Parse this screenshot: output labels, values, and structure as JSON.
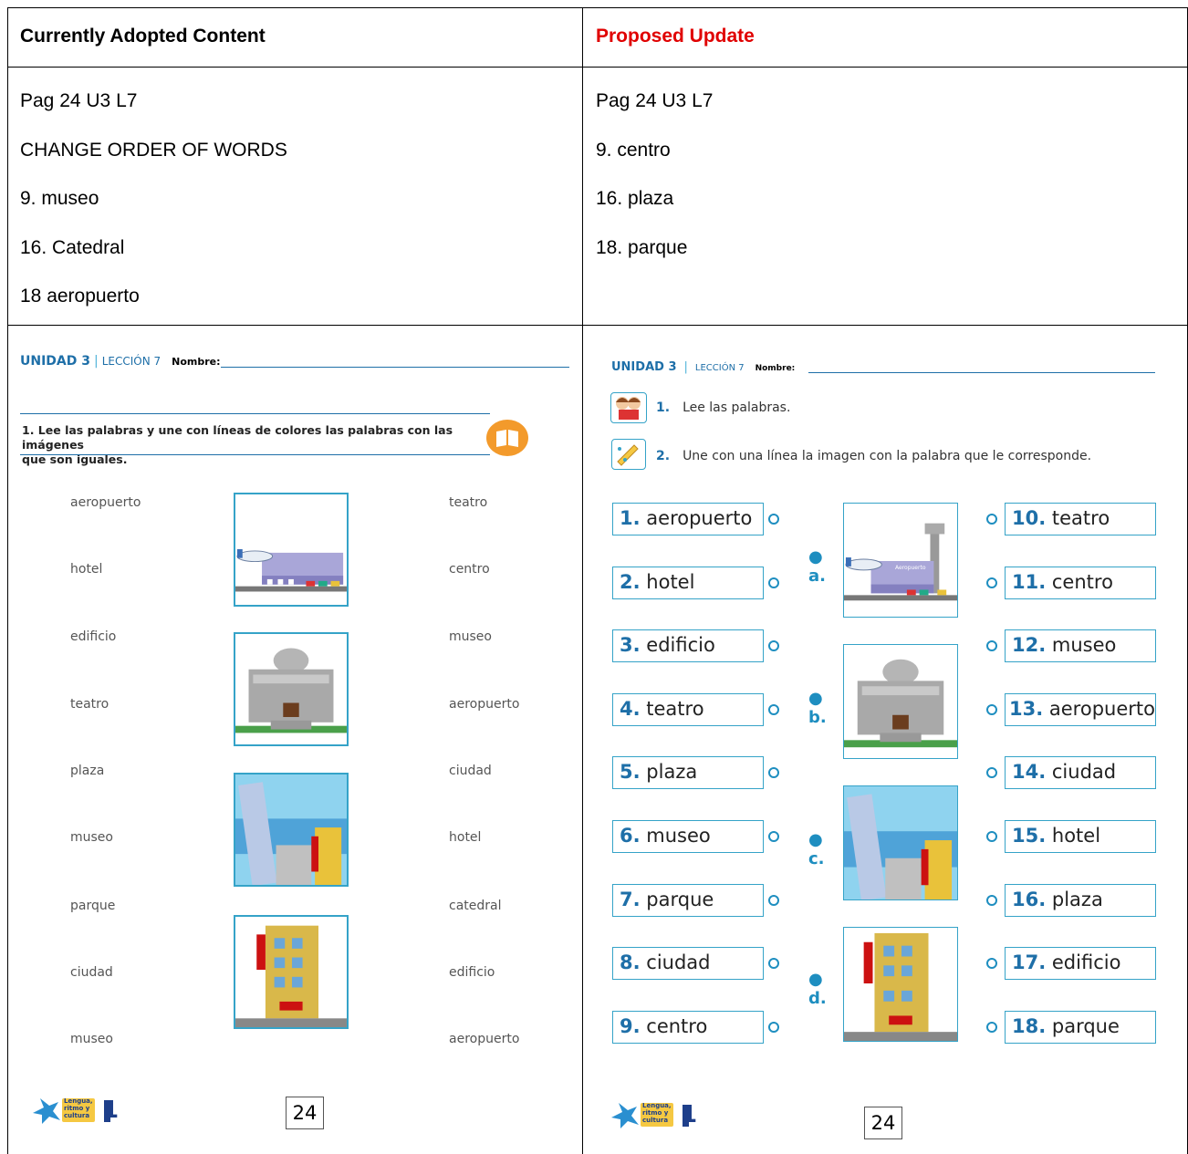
{
  "table": {
    "left_header": "Currently Adopted Content",
    "right_header": "Proposed Update",
    "left_notes": [
      "Pag 24 U3 L7",
      "CHANGE ORDER OF WORDS",
      "9. museo",
      "16. Catedral",
      "18 aeropuerto"
    ],
    "right_notes": [
      "Pag 24 U3 L7",
      "9. centro",
      "16. plaza",
      "18. parque"
    ]
  },
  "old_sheet": {
    "unidad": "UNIDAD 3",
    "leccion": "LECCIÓN 7",
    "nombre": "Nombre:",
    "instruction_line1": "1. Lee las palabras y une con líneas de colores las palabras con las imágenes",
    "instruction_line2": "que son iguales.",
    "left_words": [
      "aeropuerto",
      "hotel",
      "edificio",
      "teatro",
      "plaza",
      "museo",
      "parque",
      "ciudad",
      "museo"
    ],
    "right_words": [
      "teatro",
      "centro",
      "museo",
      "aeropuerto",
      "ciudad",
      "hotel",
      "catedral",
      "edificio",
      "aeropuerto"
    ],
    "page": "24",
    "logo_text": [
      "Lengua,",
      "ritmo y",
      "cultura"
    ],
    "logo_grade": "1"
  },
  "new_sheet": {
    "unidad": "UNIDAD 3",
    "leccion": "LECCIÓN 7",
    "nombre": "Nombre:",
    "instr1_num": "1.",
    "instr1": "Lee las palabras.",
    "instr2_num": "2.",
    "instr2": "Une con una línea la imagen con la palabra que le corresponde.",
    "left_words": [
      {
        "n": "1.",
        "w": "aeropuerto"
      },
      {
        "n": "2.",
        "w": "hotel"
      },
      {
        "n": "3.",
        "w": "edificio"
      },
      {
        "n": "4.",
        "w": "teatro"
      },
      {
        "n": "5.",
        "w": "plaza"
      },
      {
        "n": "6.",
        "w": "museo"
      },
      {
        "n": "7.",
        "w": "parque"
      },
      {
        "n": "8.",
        "w": "ciudad"
      },
      {
        "n": "9.",
        "w": "centro"
      }
    ],
    "right_words": [
      {
        "n": "10.",
        "w": "teatro"
      },
      {
        "n": "11.",
        "w": "centro"
      },
      {
        "n": "12.",
        "w": "museo"
      },
      {
        "n": "13.",
        "w": "aeropuerto"
      },
      {
        "n": "14.",
        "w": "ciudad"
      },
      {
        "n": "15.",
        "w": "hotel"
      },
      {
        "n": "16.",
        "w": "plaza"
      },
      {
        "n": "17.",
        "w": "edificio"
      },
      {
        "n": "18.",
        "w": "parque"
      }
    ],
    "picture_letters": [
      "a.",
      "b.",
      "c.",
      "d."
    ],
    "airport_sign": "Aeropuerto",
    "page": "24",
    "logo_text": [
      "Lengua,",
      "ritmo y",
      "cultura"
    ],
    "logo_grade": "1"
  },
  "colors": {
    "accent_blue": "#1e6fa8",
    "box_blue": "#35a3c8",
    "proposed_red": "#e00000",
    "book_orange": "#f39a2b"
  }
}
